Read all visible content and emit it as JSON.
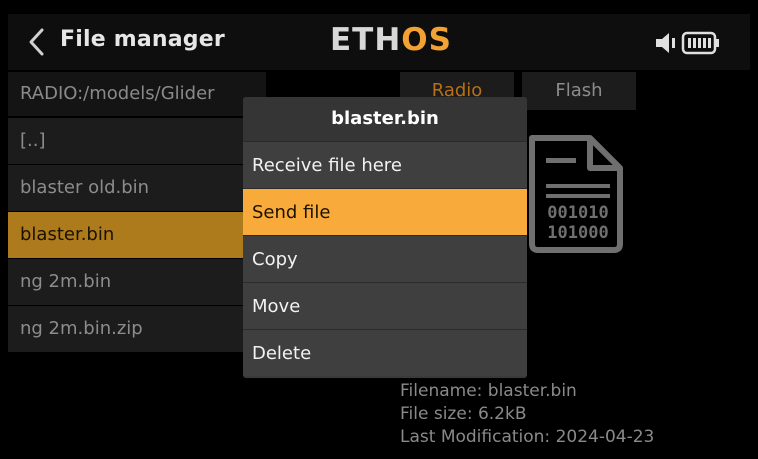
{
  "header": {
    "title": "File manager",
    "logo_a": "ETH",
    "logo_b": "OS"
  },
  "path": "RADIO:/models/Glider",
  "files": [
    {
      "name": "[..]"
    },
    {
      "name": "blaster old.bin"
    },
    {
      "name": "blaster.bin",
      "selected": true
    },
    {
      "name": "ng 2m.bin"
    },
    {
      "name": "ng 2m.bin.zip"
    }
  ],
  "tabs": {
    "radio": "Radio",
    "flash": "Flash"
  },
  "menu": {
    "title": "blaster.bin",
    "items": [
      "Receive file here",
      "Send file",
      "Copy",
      "Move",
      "Delete"
    ],
    "active_index": 1
  },
  "info": {
    "filename": "Filename: blaster.bin",
    "filesize": "File size: 6.2kB",
    "modified": "Last Modification: 2024-04-23"
  },
  "colors": {
    "accent": "#f8ab3a",
    "selected_row": "#ad7a1c",
    "logo_os": "#f2a233"
  },
  "icons": {
    "back": "chevron-left-icon",
    "speaker": "speaker-icon",
    "battery": "battery-icon",
    "file": "binary-file-icon"
  }
}
